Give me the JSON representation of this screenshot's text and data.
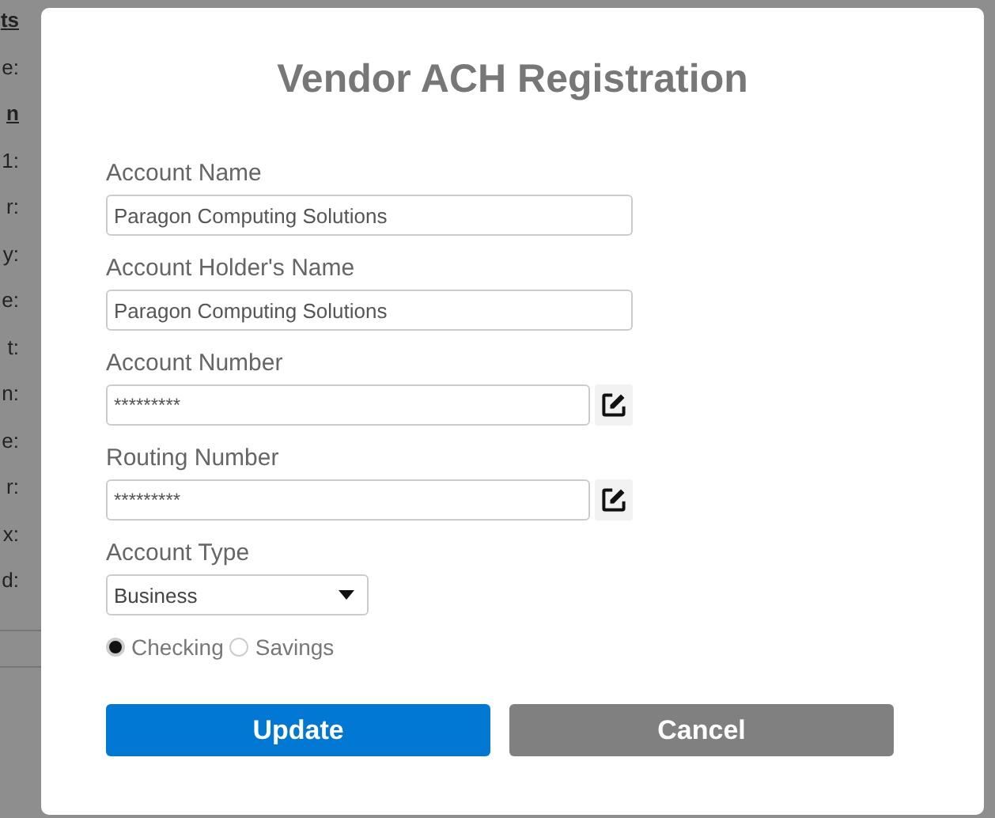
{
  "background_labels": [
    {
      "text": "ts",
      "kind": "heading"
    },
    {
      "text": "e:",
      "kind": "label"
    },
    {
      "text": "n",
      "kind": "heading"
    },
    {
      "text": "1:",
      "kind": "label"
    },
    {
      "text": "r:",
      "kind": "label"
    },
    {
      "text": "y:",
      "kind": "label"
    },
    {
      "text": "e:",
      "kind": "label"
    },
    {
      "text": "t:",
      "kind": "label"
    },
    {
      "text": "n:",
      "kind": "label"
    },
    {
      "text": "e:",
      "kind": "label"
    },
    {
      "text": "r:",
      "kind": "label"
    },
    {
      "text": "x:",
      "kind": "label"
    },
    {
      "text": "d:",
      "kind": "label"
    }
  ],
  "dialog": {
    "title": "Vendor ACH Registration",
    "fields": [
      {
        "label": "Account Name",
        "value": "Paragon Computing Solutions",
        "kind": "text"
      },
      {
        "label": "Account Holder's Name",
        "value": "Paragon Computing Solutions",
        "kind": "text"
      },
      {
        "label": "Account Number",
        "value": "*********",
        "kind": "masked"
      },
      {
        "label": "Routing Number",
        "value": "*********",
        "kind": "masked"
      },
      {
        "label": "Account Type",
        "value": "Business",
        "kind": "select"
      }
    ],
    "radios": [
      {
        "label": "Checking",
        "selected": true
      },
      {
        "label": "Savings",
        "selected": false
      }
    ],
    "buttons": [
      {
        "label": "Update",
        "kind": "primary"
      },
      {
        "label": "Cancel",
        "kind": "secondary"
      }
    ]
  }
}
